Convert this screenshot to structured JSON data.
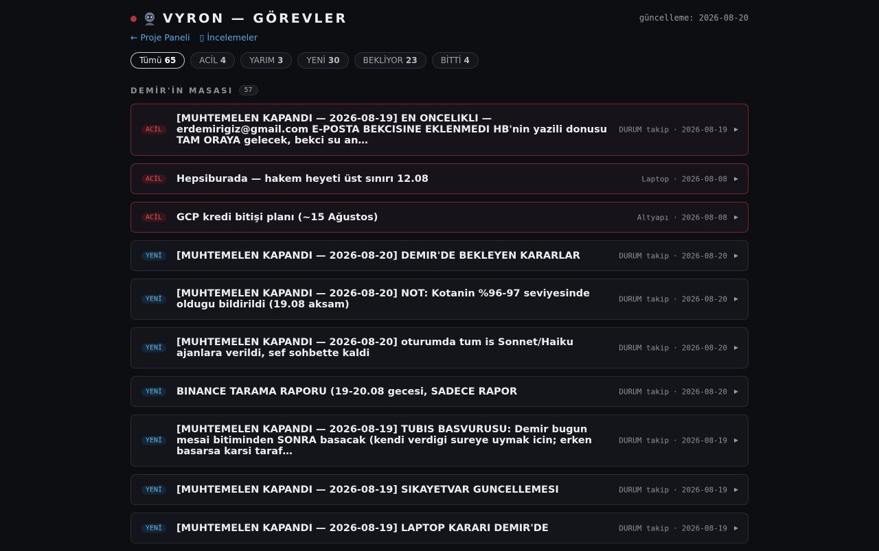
{
  "header": {
    "title": "VYRON — GÖREVLER",
    "updated": "güncelleme: 2026-08-20",
    "logo_icon": "robot-icon",
    "status_color": "#b0353a"
  },
  "links": {
    "back": "← Proje Paneli",
    "reviews": "▯ İncelemeler"
  },
  "filters": [
    {
      "label": "Tümü",
      "count": "65",
      "active": true
    },
    {
      "label": "ACİL",
      "count": "4"
    },
    {
      "label": "YARIM",
      "count": "3"
    },
    {
      "label": "YENİ",
      "count": "30"
    },
    {
      "label": "BEKLİYOR",
      "count": "23"
    },
    {
      "label": "BİTTİ",
      "count": "4"
    }
  ],
  "section": {
    "label": "DEMİR'İN MASASI",
    "count": "57"
  },
  "tasks": [
    {
      "tag": "ACİL",
      "title": "[MUHTEMELEN KAPANDI — 2026-08-19] EN ONCELIKLI — erdemirigiz@gmail.com E-POSTA BEKCISINE EKLENMEDI HB'nin yazili donusu TAM ORAYA gelecek, bekci su an…",
      "category": "DURUM takip",
      "date": "2026-08-19"
    },
    {
      "tag": "ACİL",
      "title": "Hepsiburada — hakem heyeti üst sınırı 12.08",
      "category": "Laptop",
      "date": "2026-08-08"
    },
    {
      "tag": "ACİL",
      "title": "GCP kredi bitişi planı (~15 Ağustos)",
      "category": "Altyapı",
      "date": "2026-08-08"
    },
    {
      "tag": "YENİ",
      "title": "[MUHTEMELEN KAPANDI — 2026-08-20] DEMIR'DE BEKLEYEN KARARLAR",
      "category": "DURUM takip",
      "date": "2026-08-20"
    },
    {
      "tag": "YENİ",
      "title": "[MUHTEMELEN KAPANDI — 2026-08-20] NOT: Kotanin %96-97 seviyesinde oldugu bildirildi (19.08 aksam)",
      "category": "DURUM takip",
      "date": "2026-08-20"
    },
    {
      "tag": "YENİ",
      "title": "[MUHTEMELEN KAPANDI — 2026-08-20] oturumda tum is Sonnet/Haiku ajanlara verildi, sef sohbette kaldi",
      "category": "DURUM takip",
      "date": "2026-08-20"
    },
    {
      "tag": "YENİ",
      "title": "BINANCE TARAMA RAPORU (19-20.08 gecesi, SADECE RAPOR",
      "category": "DURUM takip",
      "date": "2026-08-20"
    },
    {
      "tag": "YENİ",
      "title": "[MUHTEMELEN KAPANDI — 2026-08-19] TUBIS BASVURUSU: Demir bugun mesai bitiminden SONRA basacak (kendi verdigi sureye uymak icin; erken basarsa karsi taraf…",
      "category": "DURUM takip",
      "date": "2026-08-19"
    },
    {
      "tag": "YENİ",
      "title": "[MUHTEMELEN KAPANDI — 2026-08-19] SIKAYETVAR GUNCELLEMESI",
      "category": "DURUM takip",
      "date": "2026-08-19"
    },
    {
      "tag": "YENİ",
      "title": "[MUHTEMELEN KAPANDI — 2026-08-19] LAPTOP KARARI DEMIR'DE",
      "category": "DURUM takip",
      "date": "2026-08-19"
    }
  ]
}
